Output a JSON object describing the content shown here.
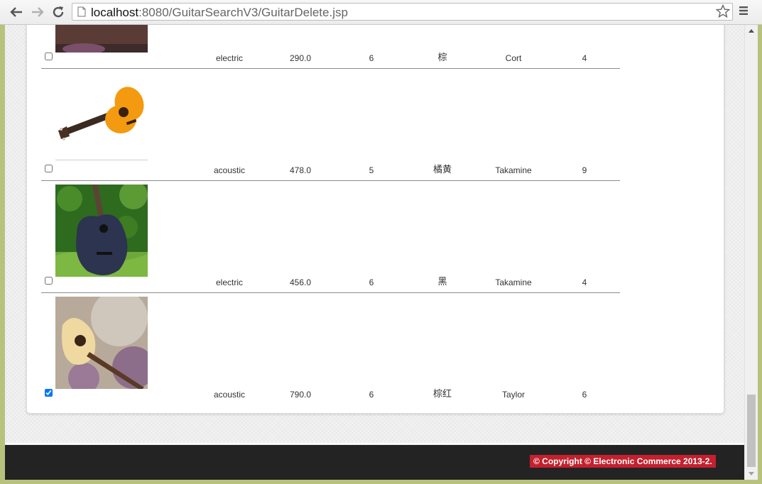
{
  "browser": {
    "url_host": "localhost",
    "url_rest": ":8080/GuitarSearchV3/GuitarDelete.jsp"
  },
  "rows": [
    {
      "type": "electric",
      "price": "290.0",
      "strings": "6",
      "color": "棕",
      "builder": "Cort",
      "stock": "4",
      "checked": false,
      "image": "partial-guitar"
    },
    {
      "type": "acoustic",
      "price": "478.0",
      "strings": "5",
      "color": "橘黄",
      "builder": "Takamine",
      "stock": "9",
      "checked": false,
      "image": "orange-acoustic-guitar"
    },
    {
      "type": "electric",
      "price": "456.0",
      "strings": "6",
      "color": "黑",
      "builder": "Takamine",
      "stock": "4",
      "checked": false,
      "image": "black-guitar-on-grass"
    },
    {
      "type": "acoustic",
      "price": "790.0",
      "strings": "6",
      "color": "棕红",
      "builder": "Taylor",
      "stock": "6",
      "checked": true,
      "image": "natural-guitar-flowers"
    }
  ],
  "footer": {
    "copyright": "© Copyright © Electronic Commerce 2013-2."
  }
}
